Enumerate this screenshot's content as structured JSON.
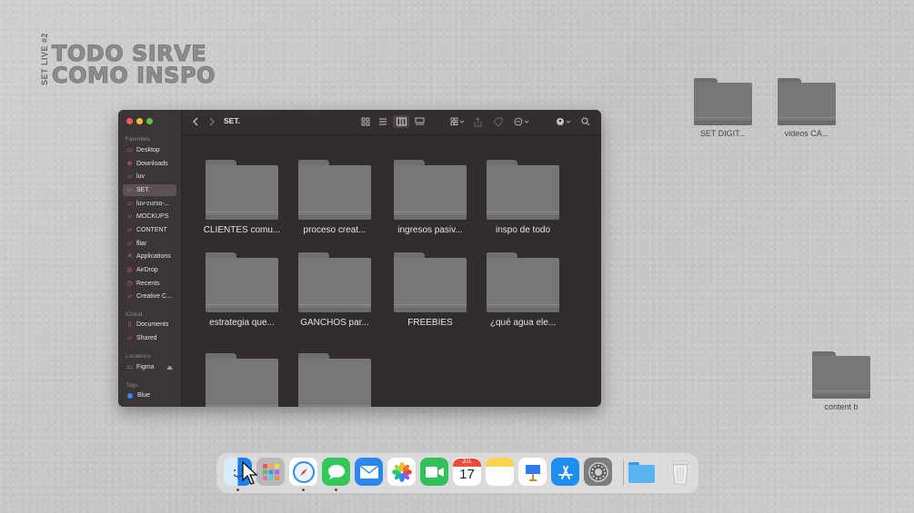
{
  "brand": {
    "side_text": "SET LIVE #2",
    "title_line1": "TODO SIRVE",
    "title_line2": "COMO INSPO"
  },
  "desktop_icons": [
    {
      "label": "SET DIGIT..."
    },
    {
      "label": "videos CA..."
    },
    {
      "label": "content b"
    }
  ],
  "finder": {
    "title": "SET.",
    "sidebar": {
      "favorites_heading": "Favorites",
      "favorites": [
        {
          "label": "Desktop",
          "icon": "desktop-icon"
        },
        {
          "label": "Downloads",
          "icon": "downloads-icon"
        },
        {
          "label": "luv",
          "icon": "folder-icon"
        },
        {
          "label": "SET.",
          "icon": "folder-icon",
          "active": true
        },
        {
          "label": "luv-curso-...",
          "icon": "folder-icon"
        },
        {
          "label": "MOCKUPS",
          "icon": "folder-icon"
        },
        {
          "label": "CONTENT",
          "icon": "folder-icon"
        },
        {
          "label": "fliar",
          "icon": "folder-icon"
        },
        {
          "label": "Applications",
          "icon": "applications-icon"
        },
        {
          "label": "AirDrop",
          "icon": "airdrop-icon"
        },
        {
          "label": "Recents",
          "icon": "recents-icon"
        },
        {
          "label": "Creative C...",
          "icon": "folder-icon"
        }
      ],
      "icloud_heading": "iCloud",
      "icloud": [
        {
          "label": "Documents",
          "icon": "document-icon"
        },
        {
          "label": "Shared",
          "icon": "shared-folder-icon"
        }
      ],
      "locations_heading": "Locations",
      "locations": [
        {
          "label": "Figma",
          "icon": "disk-icon"
        }
      ],
      "tags_heading": "Tags",
      "tags": [
        {
          "label": "Blue",
          "color": "#2f8cf0"
        }
      ]
    },
    "folders": [
      "CLIENTES comu...",
      "proceso creat...",
      "ingresos pasiv...",
      "inspo de todo",
      "estrategia que...",
      "GANCHOS par...",
      "FREEBIES",
      "¿qué agua ele...",
      "",
      ""
    ]
  },
  "dock": {
    "apps": [
      {
        "name": "finder",
        "glyph": "☺",
        "color": "#1e7ff0"
      },
      {
        "name": "launchpad",
        "glyph": "▦",
        "color": "#8a8a8a"
      },
      {
        "name": "safari",
        "glyph": "✦",
        "color": "#2a8df0"
      },
      {
        "name": "messages",
        "glyph": "💬",
        "color": "#34c759"
      },
      {
        "name": "mail",
        "glyph": "✉",
        "color": "#2b86f0"
      },
      {
        "name": "photos",
        "glyph": "✿",
        "color": "#f5f5f5"
      },
      {
        "name": "facetime",
        "glyph": "▶",
        "color": "#32c05a"
      },
      {
        "name": "calendar",
        "month": "JUL",
        "day": "17"
      },
      {
        "name": "notes",
        "glyph": "",
        "color": "#fce37a"
      },
      {
        "name": "keynote",
        "glyph": "▲",
        "color": "#2e7bf0"
      },
      {
        "name": "app-store",
        "glyph": "A",
        "color": "#1f8ef1"
      },
      {
        "name": "system-settings",
        "glyph": "⚙",
        "color": "#7d7d7d"
      },
      {
        "name": "downloads-stack",
        "glyph": "",
        "color": "#3aa2e8"
      },
      {
        "name": "trash",
        "glyph": "🗑",
        "color": "#d9d9d9"
      }
    ]
  }
}
